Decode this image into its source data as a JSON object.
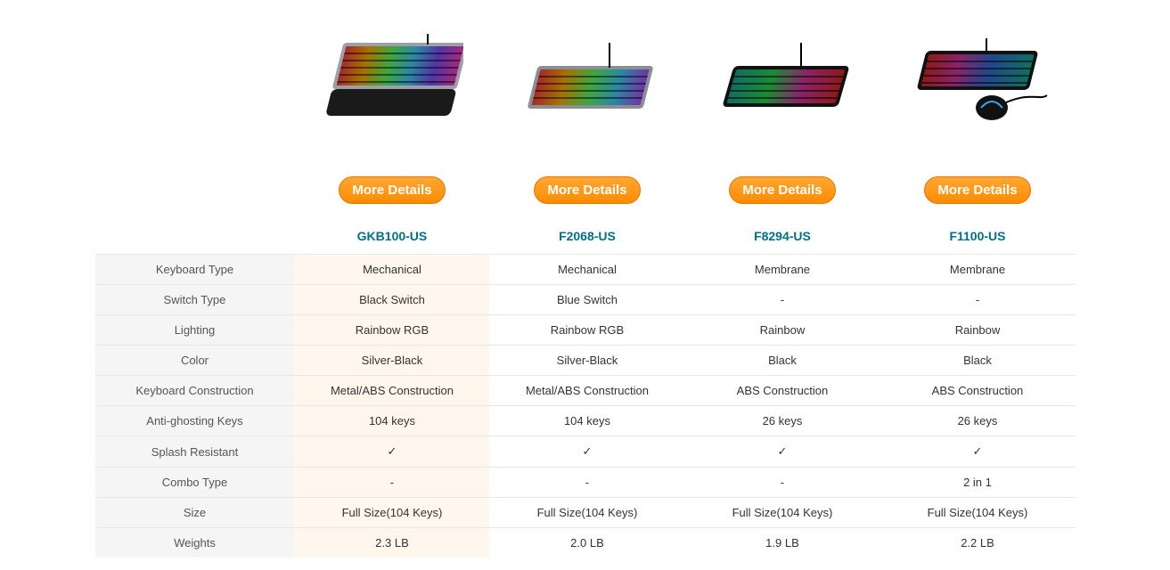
{
  "button_label": "More Details",
  "products": [
    {
      "model": "GKB100-US"
    },
    {
      "model": "F2068-US"
    },
    {
      "model": "F8294-US"
    },
    {
      "model": "F1100-US"
    }
  ],
  "specs": [
    {
      "label": "Keyboard Type",
      "values": [
        "Mechanical",
        "Mechanical",
        "Membrane",
        "Membrane"
      ]
    },
    {
      "label": "Switch Type",
      "values": [
        "Black Switch",
        "Blue Switch",
        "-",
        "-"
      ]
    },
    {
      "label": "Lighting",
      "values": [
        "Rainbow RGB",
        "Rainbow RGB",
        "Rainbow",
        "Rainbow"
      ]
    },
    {
      "label": "Color",
      "values": [
        "Silver-Black",
        "Silver-Black",
        "Black",
        "Black"
      ]
    },
    {
      "label": "Keyboard Construction",
      "values": [
        "Metal/ABS Construction",
        "Metal/ABS Construction",
        "ABS Construction",
        "ABS Construction"
      ]
    },
    {
      "label": "Anti-ghosting Keys",
      "values": [
        "104 keys",
        "104 keys",
        "26 keys",
        "26 keys"
      ]
    },
    {
      "label": "Splash Resistant",
      "values": [
        "✓",
        "✓",
        "✓",
        "✓"
      ]
    },
    {
      "label": "Combo Type",
      "values": [
        "-",
        "-",
        "-",
        "2 in 1"
      ]
    },
    {
      "label": "Size",
      "values": [
        "Full Size(104 Keys)",
        "Full Size(104 Keys)",
        "Full Size(104 Keys)",
        "Full Size(104 Keys)"
      ]
    },
    {
      "label": "Weights",
      "values": [
        "2.3 LB",
        "2.0 LB",
        "1.9 LB",
        "2.2 LB"
      ]
    }
  ]
}
